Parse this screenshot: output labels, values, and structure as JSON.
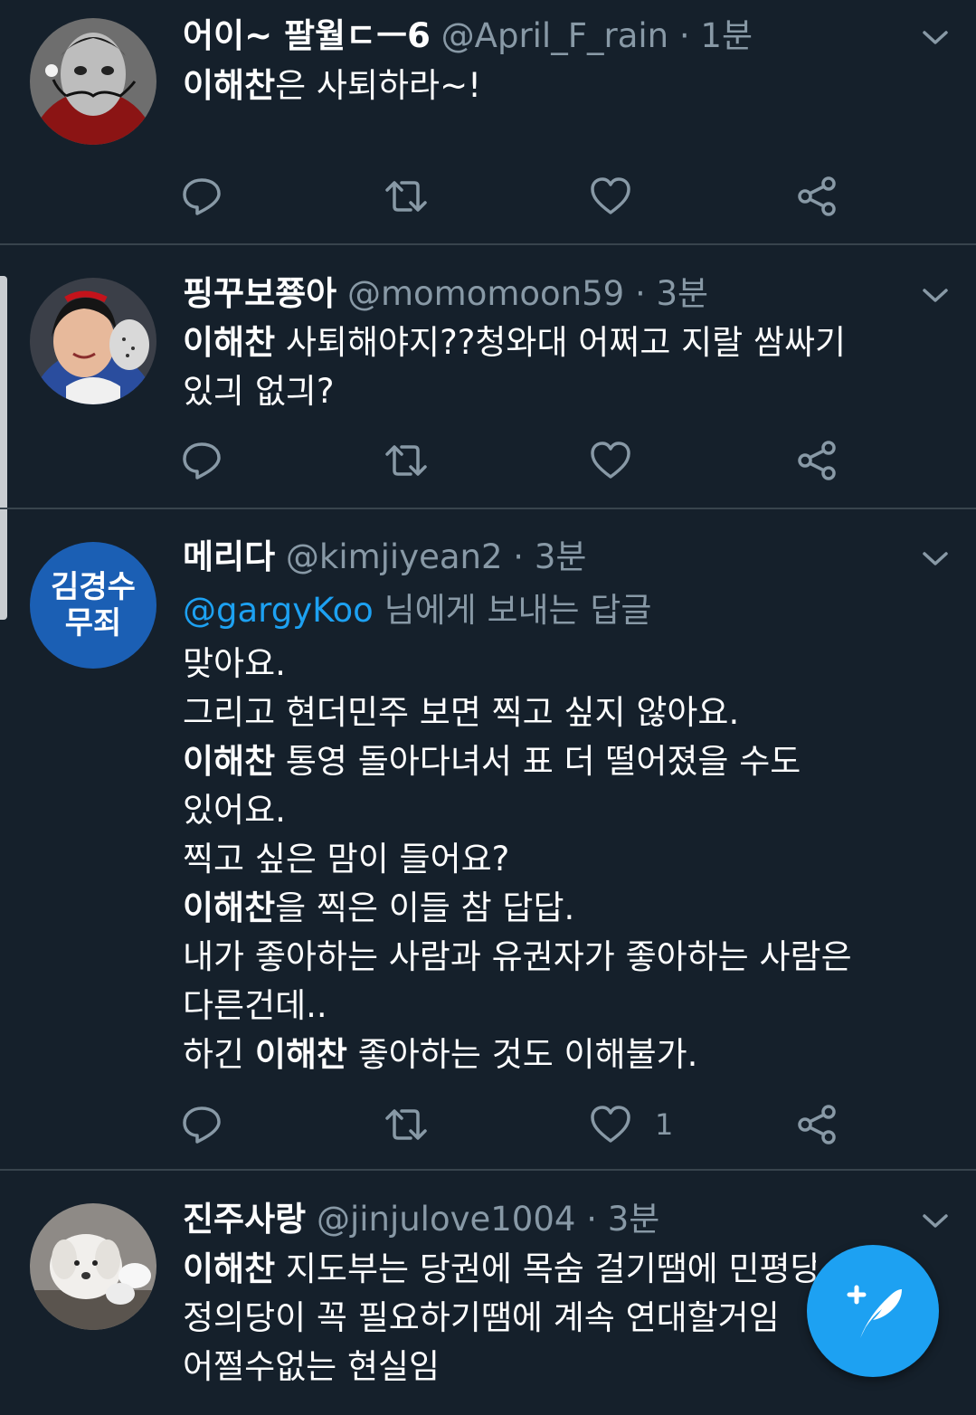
{
  "tweets": [
    {
      "display_name": "어이~ 팔월ㄷㅡ6",
      "handle": "@April_F_rain",
      "dot": "·",
      "time": "1분",
      "lines": [
        {
          "bold": "이해찬",
          "text": "은 사퇴하라~!"
        }
      ],
      "like_count": ""
    },
    {
      "display_name": "핑꾸보쭁아",
      "handle": "@momomoon59",
      "dot": "·",
      "time": "3분",
      "lines": [
        {
          "bold": "이해찬",
          "text": " 사퇴해야지??청와대 어쩌고 지랄 쌈싸기"
        },
        {
          "bold": "",
          "text": "있긔 없긔?"
        }
      ],
      "like_count": ""
    },
    {
      "display_name": "메리다",
      "handle": "@kimjiyean2",
      "dot": "·",
      "time": "3분",
      "avatar_text": [
        "김경수",
        "무죄"
      ],
      "reply_mention": "@gargyKoo",
      "reply_suffix": " 님에게 보내는 답글",
      "lines": [
        {
          "bold": "",
          "text": "맞아요."
        },
        {
          "bold": "",
          "text": "그리고 현더민주 보면 찍고 싶지 않아요."
        },
        {
          "bold": "이해찬",
          "text": " 통영 돌아다녀서 표 더 떨어졌을 수도"
        },
        {
          "bold": "",
          "text": "있어요."
        },
        {
          "bold": "",
          "text": "찍고 싶은 맘이 들어요?"
        },
        {
          "bold": "이해찬",
          "text": "을 찍은 이들 참 답답."
        },
        {
          "bold": "",
          "text": "내가 좋아하는 사람과 유권자가 좋아하는 사람은"
        },
        {
          "bold": "",
          "text": "다른건데.."
        },
        {
          "pre": "하긴 ",
          "bold": "이해찬",
          "text": " 좋아하는 것도 이해불가."
        }
      ],
      "like_count": "1"
    },
    {
      "display_name": "진주사랑",
      "handle": "@jinjulove1004",
      "dot": "·",
      "time": "3분",
      "lines": [
        {
          "bold": "이해찬",
          "text": " 지도부는 당권에 목숨 걸기땜에 민평당"
        },
        {
          "bold": "",
          "text": "정의당이 꼭 필요하기땜에 계속 연대할거임"
        },
        {
          "bold": "",
          "text": "어쩔수없는 현실임"
        }
      ],
      "like_count": ""
    }
  ],
  "icons": {
    "reply": "reply-icon",
    "retweet": "retweet-icon",
    "like": "heart-icon",
    "share": "share-icon",
    "caret": "chevron-down-icon",
    "compose": "compose-tweet-icon"
  },
  "colors": {
    "background": "#15202b",
    "divider": "#38444d",
    "secondary_text": "#8899a6",
    "accent": "#1da1f2"
  }
}
